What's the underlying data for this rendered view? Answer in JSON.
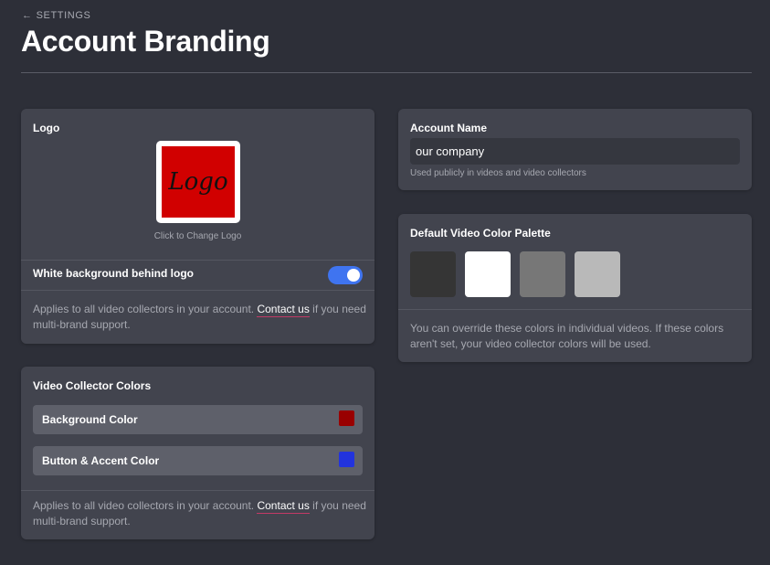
{
  "header": {
    "back_label": "SETTINGS",
    "back_icon": "arrow-left-icon",
    "title": "Account Branding"
  },
  "logo_card": {
    "label": "Logo",
    "logo_text": "Logo",
    "logo_bg_color": "#d10000",
    "change_caption": "Click to Change Logo",
    "toggle_label": "White background behind logo",
    "toggle_on": true,
    "help_prefix": "Applies to all video collectors in your account. ",
    "help_link": "Contact us",
    "help_suffix": " if you need multi-brand support."
  },
  "collector_card": {
    "label": "Video Collector Colors",
    "rows": [
      {
        "label": "Background Color",
        "color": "#990000"
      },
      {
        "label": "Button & Accent Color",
        "color": "#2233dd"
      }
    ],
    "help_prefix": "Applies to all video collectors in your account. ",
    "help_link": "Contact us",
    "help_suffix": " if you need multi-brand support."
  },
  "account_card": {
    "label": "Account Name",
    "value": "our company",
    "help": "Used publicly in videos and video collectors"
  },
  "palette_card": {
    "label": "Default Video Color Palette",
    "swatches": [
      "#353535",
      "#ffffff",
      "#777777",
      "#b9b9b9"
    ],
    "help": "You can override these colors in individual videos. If these colors aren't set, your video collector colors will be used."
  },
  "colors": {
    "background": "#2d2f38",
    "card": "#42444e",
    "toggle_accent": "#3f74f0",
    "link_underline": "#c23a66"
  }
}
